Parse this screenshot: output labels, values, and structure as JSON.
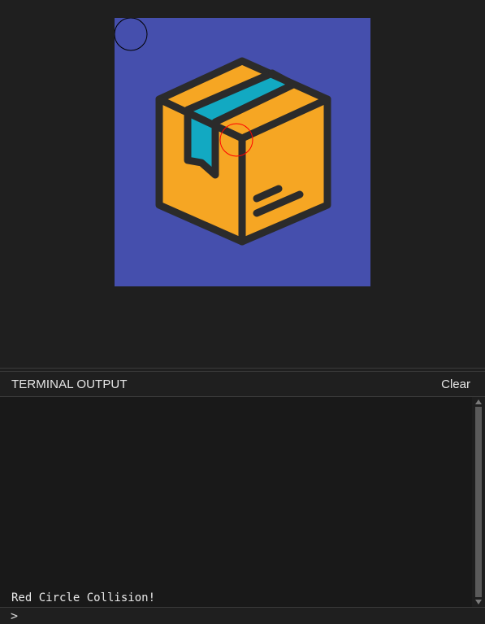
{
  "terminal": {
    "title": "TERMINAL OUTPUT",
    "clear_label": "Clear",
    "output_lines": [
      "Red Circle Collision!"
    ],
    "prompt_symbol": ">",
    "input_value": ""
  },
  "stage": {
    "sprite": "package-box-icon",
    "colors": {
      "backdrop": "#454fad",
      "box_front": "#f6a623",
      "ribbon": "#12a9c2",
      "outline": "#2b2b2b",
      "black_circle": "#000000",
      "red_circle": "#ff0000"
    }
  },
  "theme": {
    "background": "#1f1f1f",
    "output_background": "#191919",
    "text": "#e6e6e6"
  }
}
